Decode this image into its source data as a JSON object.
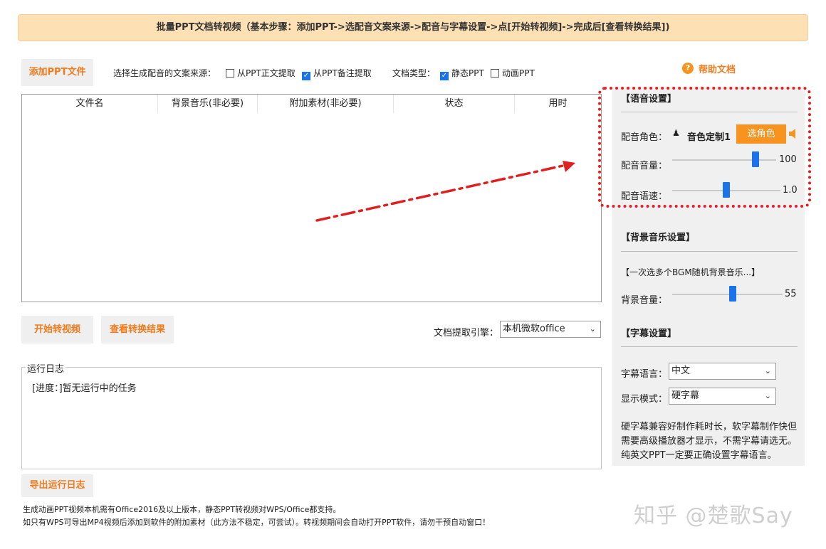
{
  "banner": "批量PPT文档转视频（基本步骤：添加PPT->选配音文案来源->配音与字幕设置->点[开始转视频]->完成后[查看转换结果])",
  "toolbar": {
    "add_ppt": "添加PPT文件",
    "source_label": "选择生成配音的文案来源：",
    "source_body": "从PPT正文提取",
    "source_notes": "从PPT备注提取",
    "doc_type_label": "文档类型：",
    "type_static": "静态PPT",
    "type_animated": "动画PPT",
    "help": "帮助文档"
  },
  "checks": {
    "source_body": false,
    "source_notes": true,
    "type_static": true,
    "type_animated": false
  },
  "table": {
    "columns": [
      "文件名",
      "背景音乐(非必要)",
      "附加素材(非必要)",
      "状态",
      "用时"
    ],
    "rows": []
  },
  "actions": {
    "start": "开始转视频",
    "view_results": "查看转换结果",
    "engine_label": "文档提取引擎：",
    "engine_value": "本机微软office"
  },
  "log": {
    "legend": "运行日志",
    "text": "[进度：]暂无运行中的任务",
    "export": "导出运行日志"
  },
  "footer": {
    "line1": "生成动画PPT视频本机需有Office2016及以上版本，静态PPT转视频对WPS/Office都支持。",
    "line2": "如只有WPS可导出MP4视频后添加到软件的附加素材（此方法不稳定，可尝试）。转视频期间会自动打开PPT软件，请勿干预自动窗口！"
  },
  "voice": {
    "title": "【语音设置】",
    "role_label": "配音角色：",
    "role_value": "音色定制1",
    "choose_role": "选角色",
    "volume_label": "配音音量：",
    "volume_value": "100",
    "volume_level": 0.8,
    "speed_label": "配音语速：",
    "speed_value": "1.0",
    "speed_level": 0.5
  },
  "bgm": {
    "title": "【背景音乐设置】",
    "hint": "【一次选多个BGM随机背景音乐...】",
    "volume_label": "背景音量：",
    "volume_value": "55",
    "volume_level": 0.55
  },
  "subtitle": {
    "title": "【字幕设置】",
    "lang_label": "字幕语言：",
    "lang_value": "中文",
    "mode_label": "显示模式：",
    "mode_value": "硬字幕",
    "note": "硬字幕兼容好制作耗时长，软字幕制作快但需要高级播放器才显示，不需字幕请选无。纯英文PPT一定要正确设置字幕语言。"
  },
  "watermark": "知乎 @楚歌Say",
  "colors": {
    "accent": "#f7931e",
    "button_text": "#f07c1e",
    "banner_bg": "#fde1b4",
    "annotation_red": "#e02020",
    "check_blue": "#1a73e8"
  }
}
